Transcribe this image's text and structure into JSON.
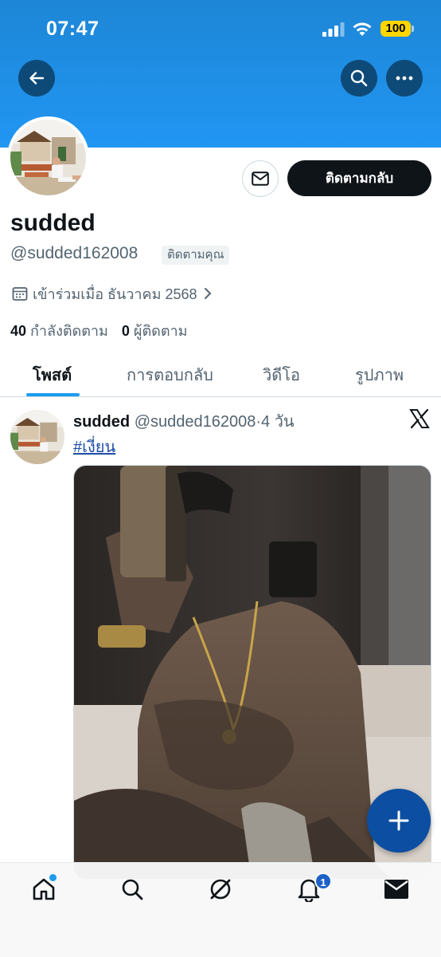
{
  "status_bar": {
    "time": "07:47",
    "battery": "100"
  },
  "header": {
    "icons": [
      "back-arrow-icon",
      "search-icon",
      "more-icon"
    ]
  },
  "profile": {
    "display_name": "sudded",
    "handle": "@sudded162008",
    "follows_you_badge": "ติดตามคุณ",
    "follow_back_label": "ติดตามกลับ",
    "joined": "เข้าร่วมเมื่อ ธันวาคม 2568",
    "following_count": "40",
    "following_label": "กำลังติดตาม",
    "followers_count": "0",
    "followers_label": "ผู้ติดตาม"
  },
  "tabs": [
    {
      "label": "โพสต์",
      "active": true
    },
    {
      "label": "การตอบกลับ",
      "active": false
    },
    {
      "label": "วิดีโอ",
      "active": false
    },
    {
      "label": "รูปภาพ",
      "active": false
    }
  ],
  "post": {
    "author": "sudded",
    "handle": "@sudded162008",
    "separator": "·",
    "age": "4 วัน",
    "hashtag": "#เงี่ยน"
  },
  "bottom_nav": {
    "items": [
      "home-icon",
      "search-icon",
      "grok-icon",
      "notifications-icon",
      "messages-icon"
    ],
    "notification_badge": "1"
  },
  "colors": {
    "banner": "#2196f3",
    "accent": "#1d9bf0",
    "fab": "#0b4ea2",
    "text": "#0f1419",
    "muted": "#536471"
  }
}
